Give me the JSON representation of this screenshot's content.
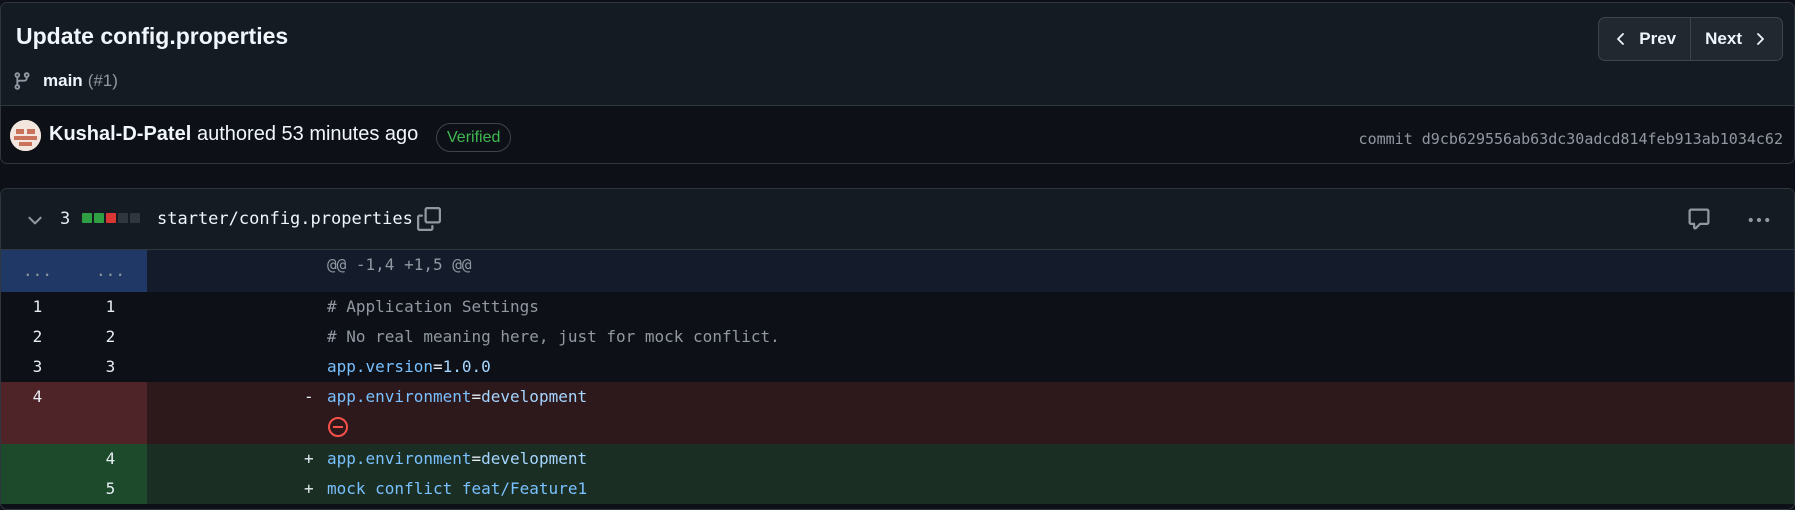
{
  "commit": {
    "title": "Update config.properties",
    "branch": "main",
    "pr_ref": "(#1)",
    "author": "Kushal-D-Patel",
    "authored_text": "authored 53 minutes ago",
    "verified_label": "Verified",
    "hash_label": "commit d9cb629556ab63dc30adcd814feb913ab1034c62"
  },
  "nav": {
    "prev_label": "Prev",
    "next_label": "Next"
  },
  "file": {
    "change_count": "3",
    "path": "starter/config.properties",
    "diffstat_colors": [
      "#2ea043",
      "#2ea043",
      "#da3633",
      "#30363d",
      "#30363d"
    ]
  },
  "diff": {
    "hunk_old": "...",
    "hunk_new": "...",
    "hunk_header": "@@ -1,4 +1,5 @@",
    "lines": [
      {
        "old": "1",
        "new": "1",
        "text": "# Application Settings"
      },
      {
        "old": "2",
        "new": "2",
        "text": "# No real meaning here, just for mock conflict."
      },
      {
        "old": "3",
        "new": "3",
        "key": "app.version",
        "eq": "=",
        "value": "1.0.0"
      },
      {
        "old": "4",
        "new": "",
        "marker": "-",
        "key": "app.environment",
        "eq": "=",
        "value": "development"
      },
      {
        "old": "",
        "new": "4",
        "marker": "+",
        "key": "app.environment",
        "eq": "=",
        "value": "development"
      },
      {
        "old": "",
        "new": "5",
        "marker": "+",
        "text": "mock conflict feat/Feature1"
      }
    ]
  },
  "colors": {
    "added": "#2ea043",
    "deleted": "#da3633",
    "verified": "#3fb950",
    "link": "#79c0ff"
  }
}
